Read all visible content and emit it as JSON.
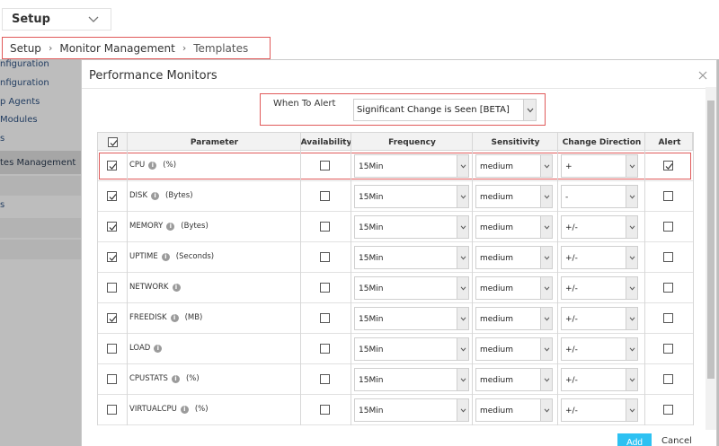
{
  "header": {
    "setup_label": "Setup",
    "breadcrumb": [
      "Setup",
      "Monitor Management",
      "Templates"
    ]
  },
  "sidebar": {
    "items": [
      "nfiguration",
      "nfiguration",
      "p Agents",
      "Modules",
      "s",
      "tes Management",
      "s"
    ]
  },
  "modal": {
    "title": "Performance Monitors",
    "when_to_alert_label": "When To Alert",
    "when_to_alert_value": "Significant Change is Seen [BETA]",
    "columns": [
      "Parameter",
      "Availability",
      "Frequency",
      "Sensitivity",
      "Change Direction",
      "Alert"
    ],
    "rows": [
      {
        "param": "CPU",
        "unit": "(%)",
        "checked": true,
        "availability": false,
        "frequency": "15Min",
        "sensitivity": "medium",
        "direction": "+",
        "alert": true
      },
      {
        "param": "DISK",
        "unit": "(Bytes)",
        "checked": true,
        "availability": false,
        "frequency": "15Min",
        "sensitivity": "medium",
        "direction": "-",
        "alert": false
      },
      {
        "param": "MEMORY",
        "unit": "(Bytes)",
        "checked": true,
        "availability": false,
        "frequency": "15Min",
        "sensitivity": "medium",
        "direction": "+/-",
        "alert": false
      },
      {
        "param": "UPTIME",
        "unit": "(Seconds)",
        "checked": true,
        "availability": false,
        "frequency": "15Min",
        "sensitivity": "medium",
        "direction": "+/-",
        "alert": false
      },
      {
        "param": "NETWORK",
        "unit": "",
        "checked": false,
        "availability": false,
        "frequency": "15Min",
        "sensitivity": "medium",
        "direction": "+/-",
        "alert": false
      },
      {
        "param": "FREEDISK",
        "unit": "(MB)",
        "checked": true,
        "availability": false,
        "frequency": "15Min",
        "sensitivity": "medium",
        "direction": "+/-",
        "alert": false
      },
      {
        "param": "LOAD",
        "unit": "",
        "checked": false,
        "availability": false,
        "frequency": "15Min",
        "sensitivity": "medium",
        "direction": "+/-",
        "alert": false
      },
      {
        "param": "CPUSTATS",
        "unit": "(%)",
        "checked": false,
        "availability": false,
        "frequency": "15Min",
        "sensitivity": "medium",
        "direction": "+/-",
        "alert": false
      },
      {
        "param": "VIRTUALCPU",
        "unit": "(%)",
        "checked": false,
        "availability": false,
        "frequency": "15Min",
        "sensitivity": "medium",
        "direction": "+/-",
        "alert": false
      }
    ],
    "add_label": "Add",
    "cancel_label": "Cancel"
  },
  "colors": {
    "accent": "#2dc1f2",
    "highlight": "#e05a5a"
  }
}
